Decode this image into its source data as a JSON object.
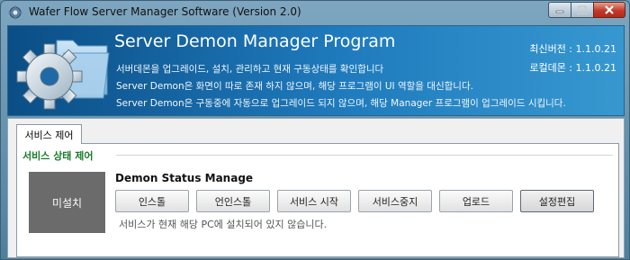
{
  "window": {
    "title": "Wafer Flow Server Manager Software (Version 2.0)",
    "controls": {
      "minimize": "minimize",
      "maximize": "maximize",
      "close": "close"
    }
  },
  "banner": {
    "title": "Server Demon Manager Program",
    "lines": [
      "서버데몬을 업그레이드, 설치, 관리하고 현재 구동상태를 확인합니다",
      "Server Demon은 화면이 따로 존재 하지 않으며, 해당 프로그램이 UI 역할을 대신합니다.",
      "Server Demon은 구동중에 자동으로 업그레이드 되지 않으며, 해당 Manager 프로그램이 업그레이드 시킵니다."
    ],
    "latest_version": "최신버전 : 1.1.0.21",
    "local_demon": "로컬데몬 : 1.1.0.21",
    "icon": "gear-folder-icon"
  },
  "tabs": [
    {
      "label": "서비스 제어",
      "active": true
    }
  ],
  "panel": {
    "group_title": "서비스 상태 제어",
    "status_box_label": "미설치",
    "status_title": "Demon Status Manage",
    "buttons": [
      "인스톨",
      "언인스톨",
      "서비스 시작",
      "서비스중지",
      "업로드",
      "설정편집"
    ],
    "message": "서비스가 현재 해당 PC에 설치되어 있지 않습니다."
  }
}
